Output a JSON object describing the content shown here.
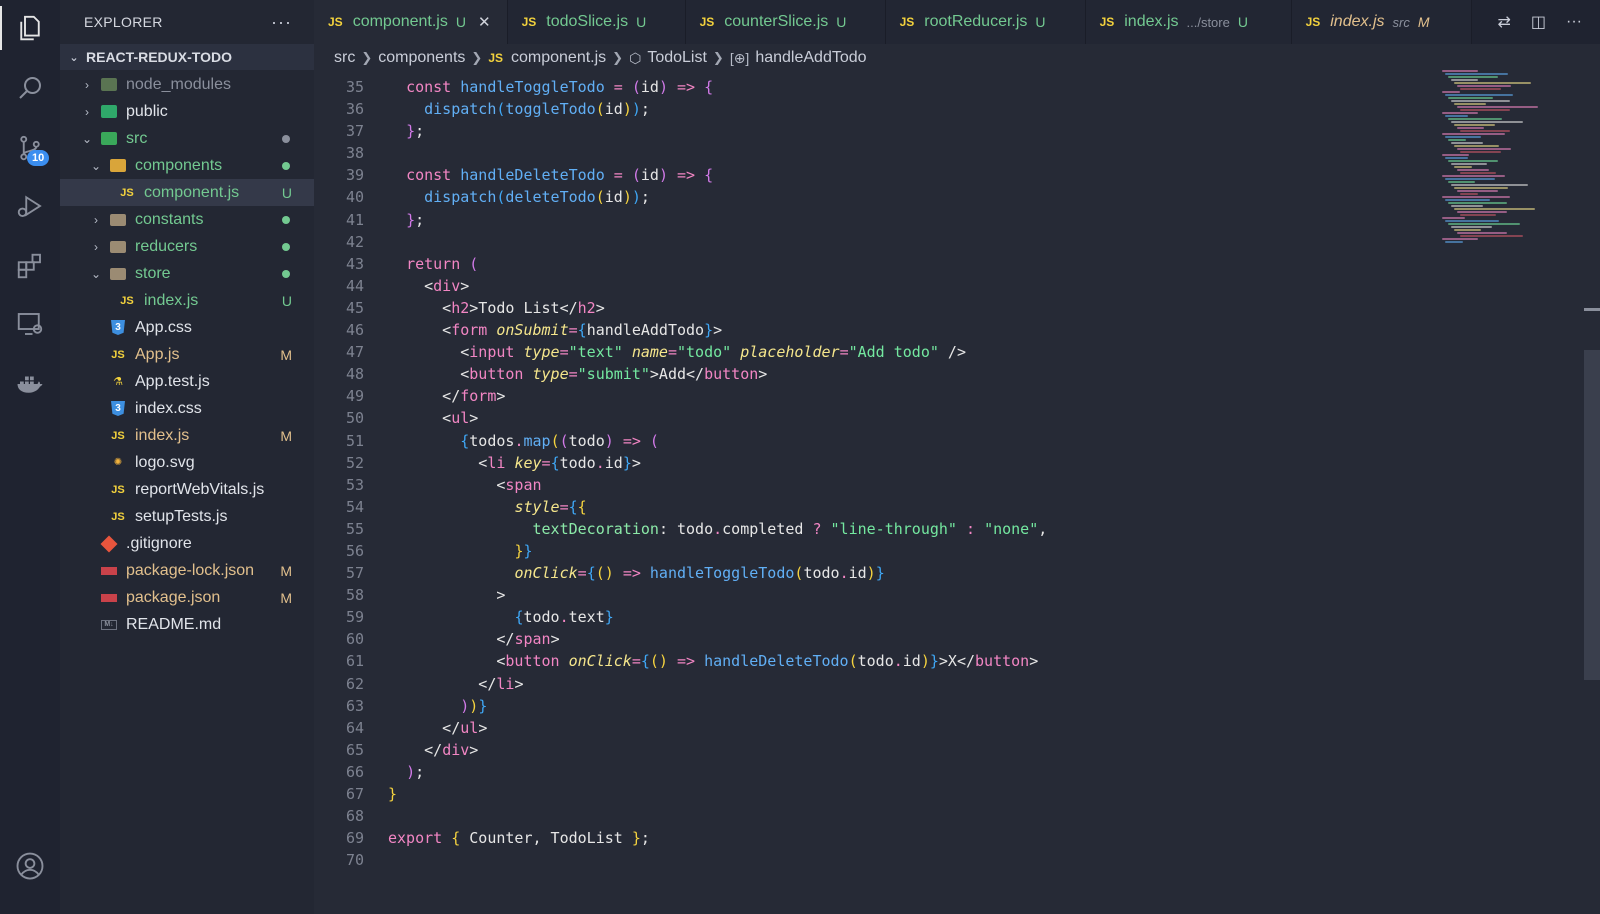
{
  "activity_bar": {
    "scm_badge": "10"
  },
  "sidebar": {
    "title": "EXPLORER",
    "more": "···",
    "project": "REACT-REDUX-TODO",
    "tree": [
      {
        "name": "node_modules",
        "depth": 1,
        "kind": "folder",
        "expanded": false,
        "color": "c-grey",
        "icon": "node"
      },
      {
        "name": "public",
        "depth": 1,
        "kind": "folder",
        "expanded": false,
        "color": "c-white",
        "icon": "public"
      },
      {
        "name": "src",
        "depth": 1,
        "kind": "folder",
        "expanded": true,
        "color": "c-green",
        "icon": "src",
        "dot": "#8a8f9c"
      },
      {
        "name": "components",
        "depth": 2,
        "kind": "folder",
        "expanded": true,
        "color": "c-green",
        "icon": "folder-gold",
        "dot": "#73c991"
      },
      {
        "name": "component.js",
        "depth": 3,
        "kind": "file",
        "color": "c-green",
        "icon": "js",
        "status": "U",
        "selected": true
      },
      {
        "name": "constants",
        "depth": 2,
        "kind": "folder",
        "expanded": false,
        "color": "c-green",
        "icon": "folder",
        "dot": "#73c991"
      },
      {
        "name": "reducers",
        "depth": 2,
        "kind": "folder",
        "expanded": false,
        "color": "c-green",
        "icon": "folder",
        "dot": "#73c991"
      },
      {
        "name": "store",
        "depth": 2,
        "kind": "folder",
        "expanded": true,
        "color": "c-green",
        "icon": "folder",
        "dot": "#73c991"
      },
      {
        "name": "index.js",
        "depth": 3,
        "kind": "file",
        "color": "c-green",
        "icon": "js",
        "status": "U"
      },
      {
        "name": "App.css",
        "depth": 2,
        "kind": "file",
        "color": "c-white",
        "icon": "css"
      },
      {
        "name": "App.js",
        "depth": 2,
        "kind": "file",
        "color": "c-gold",
        "icon": "js",
        "status": "M"
      },
      {
        "name": "App.test.js",
        "depth": 2,
        "kind": "file",
        "color": "c-white",
        "icon": "test"
      },
      {
        "name": "index.css",
        "depth": 2,
        "kind": "file",
        "color": "c-white",
        "icon": "css"
      },
      {
        "name": "index.js",
        "depth": 2,
        "kind": "file",
        "color": "c-gold",
        "icon": "js",
        "status": "M"
      },
      {
        "name": "logo.svg",
        "depth": 2,
        "kind": "file",
        "color": "c-white",
        "icon": "svg"
      },
      {
        "name": "reportWebVitals.js",
        "depth": 2,
        "kind": "file",
        "color": "c-white",
        "icon": "js"
      },
      {
        "name": "setupTests.js",
        "depth": 2,
        "kind": "file",
        "color": "c-white",
        "icon": "js"
      },
      {
        "name": ".gitignore",
        "depth": 1,
        "kind": "file",
        "color": "c-white",
        "icon": "git"
      },
      {
        "name": "package-lock.json",
        "depth": 1,
        "kind": "file",
        "color": "c-gold",
        "icon": "npm",
        "status": "M"
      },
      {
        "name": "package.json",
        "depth": 1,
        "kind": "file",
        "color": "c-gold",
        "icon": "npm",
        "status": "M"
      },
      {
        "name": "README.md",
        "depth": 1,
        "kind": "file",
        "color": "c-white",
        "icon": "md"
      }
    ]
  },
  "tabs": [
    {
      "label": "component.js",
      "status": "U",
      "active": true,
      "close": "✕",
      "icon_label": "JS"
    },
    {
      "label": "todoSlice.js",
      "status": "U",
      "icon_label": "JS"
    },
    {
      "label": "counterSlice.js",
      "status": "U",
      "icon_label": "JS"
    },
    {
      "label": "rootReducer.js",
      "status": "U",
      "icon_label": "JS"
    },
    {
      "label": "index.js",
      "desc": ".../store",
      "status": "U",
      "icon_label": "JS"
    },
    {
      "label": "index.js",
      "desc": "src",
      "status": "M",
      "italic": true,
      "gold": true,
      "icon_label": "JS"
    }
  ],
  "breadcrumb": {
    "parts": [
      "src",
      "components",
      "component.js",
      "TodoList",
      "handleAddTodo"
    ],
    "js_label": "JS"
  },
  "editor": {
    "line_numbers": [
      "35",
      "36",
      "37",
      "38",
      "39",
      "40",
      "41",
      "42",
      "43",
      "44",
      "45",
      "46",
      "47",
      "48",
      "49",
      "50",
      "51",
      "52",
      "53",
      "54",
      "55",
      "56",
      "57",
      "58",
      "59",
      "60",
      "61",
      "62",
      "63",
      "64",
      "65",
      "66",
      "67",
      "68",
      "69",
      "70"
    ]
  },
  "colors": {
    "accent_green": "#73c991",
    "accent_gold": "#e2c08d",
    "badge_blue": "#3b8ef0",
    "editor_bg": "#262a36"
  }
}
